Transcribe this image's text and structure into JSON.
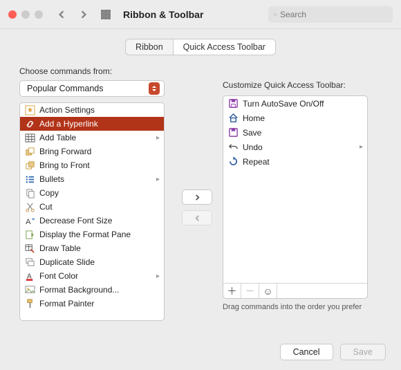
{
  "header": {
    "title": "Ribbon & Toolbar",
    "search_placeholder": "Search"
  },
  "tabs": {
    "ribbon": "Ribbon",
    "qat": "Quick Access Toolbar"
  },
  "left": {
    "label": "Choose commands from:",
    "dropdown": "Popular Commands",
    "items": [
      {
        "label": "Action Settings",
        "icon": "star",
        "submenu": false
      },
      {
        "label": "Add a Hyperlink",
        "icon": "link",
        "submenu": false,
        "selected": true
      },
      {
        "label": "Add Table",
        "icon": "table",
        "submenu": true
      },
      {
        "label": "Bring Forward",
        "icon": "bring-forward",
        "submenu": false
      },
      {
        "label": "Bring to Front",
        "icon": "bring-front",
        "submenu": false
      },
      {
        "label": "Bullets",
        "icon": "bullets",
        "submenu": true
      },
      {
        "label": "Copy",
        "icon": "copy",
        "submenu": false
      },
      {
        "label": "Cut",
        "icon": "cut",
        "submenu": false
      },
      {
        "label": "Decrease Font Size",
        "icon": "font-decrease",
        "submenu": false
      },
      {
        "label": "Display the Format Pane",
        "icon": "format-pane",
        "submenu": false
      },
      {
        "label": "Draw Table",
        "icon": "draw-table",
        "submenu": false
      },
      {
        "label": "Duplicate Slide",
        "icon": "duplicate",
        "submenu": false
      },
      {
        "label": "Font Color",
        "icon": "font-color",
        "submenu": true
      },
      {
        "label": "Format Background...",
        "icon": "format-bg",
        "submenu": false
      },
      {
        "label": "Format Painter",
        "icon": "painter",
        "submenu": false
      }
    ]
  },
  "right": {
    "label": "Customize Quick Access Toolbar:",
    "items": [
      {
        "label": "Turn AutoSave On/Off",
        "icon": "autosave"
      },
      {
        "label": "Home",
        "icon": "home"
      },
      {
        "label": "Save",
        "icon": "save"
      },
      {
        "label": "Undo",
        "icon": "undo",
        "submenu": true
      },
      {
        "label": "Repeat",
        "icon": "repeat"
      }
    ],
    "hint": "Drag commands into the order you prefer"
  },
  "footer": {
    "cancel": "Cancel",
    "save": "Save"
  }
}
